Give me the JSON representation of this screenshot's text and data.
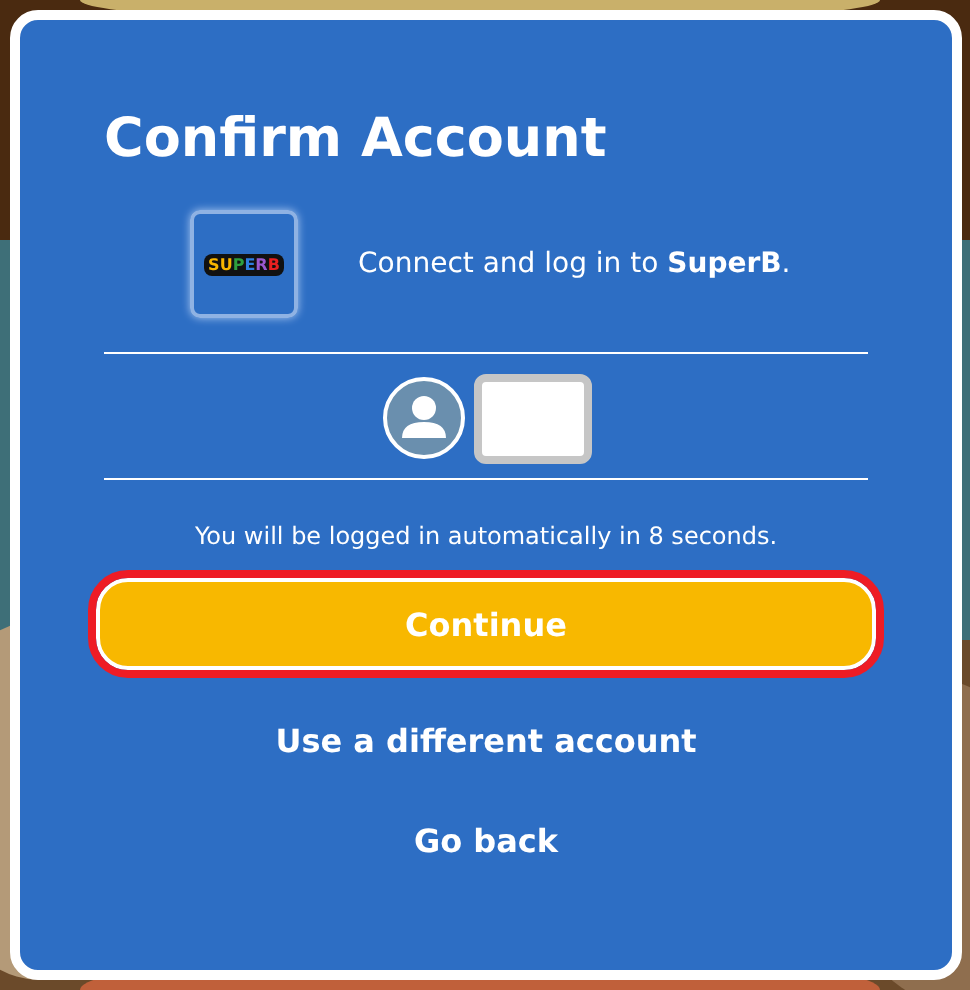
{
  "dialog": {
    "title": "Confirm Account",
    "app": {
      "logo_text": "SUPERB",
      "message": "Connect and log in to **SuperB**."
    },
    "account": {
      "redacted": true
    },
    "notice": "You will be logged in automatically in 8 seconds.",
    "buttons": [
      {
        "label": "Continue",
        "kind": "primary",
        "highlighted": true
      },
      {
        "label": "Use a different account",
        "kind": "link",
        "highlighted": false
      },
      {
        "label": "Go back",
        "kind": "link",
        "highlighted": false
      }
    ]
  }
}
